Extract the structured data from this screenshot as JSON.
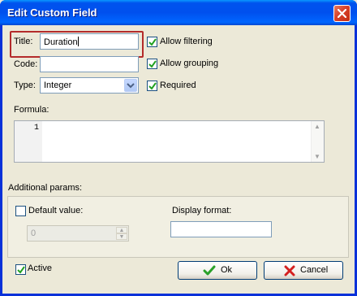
{
  "window": {
    "title": "Edit Custom Field"
  },
  "form": {
    "title_label": "Title:",
    "title_value": "Duration",
    "code_label": "Code:",
    "code_value": "",
    "type_label": "Type:",
    "type_value": "Integer",
    "allow_filtering": {
      "label": "Allow filtering",
      "checked": true
    },
    "allow_grouping": {
      "label": "Allow grouping",
      "checked": true
    },
    "required": {
      "label": "Required",
      "checked": true
    },
    "formula_label": "Formula:",
    "formula_line_number": "1"
  },
  "additional": {
    "label": "Additional params:",
    "default_value": {
      "label": "Default value:",
      "checked": false,
      "value": "0"
    },
    "display_format": {
      "label": "Display format:",
      "value": ""
    }
  },
  "footer": {
    "active": {
      "label": "Active",
      "checked": true
    },
    "ok_label": "Ok",
    "cancel_label": "Cancel"
  },
  "colors": {
    "highlight": "#b42b2b",
    "ok_check": "#2aa12a",
    "cancel_x": "#d42020"
  },
  "icons": {
    "close": "close-icon",
    "ok": "checkmark-icon",
    "cancel": "x-icon"
  }
}
